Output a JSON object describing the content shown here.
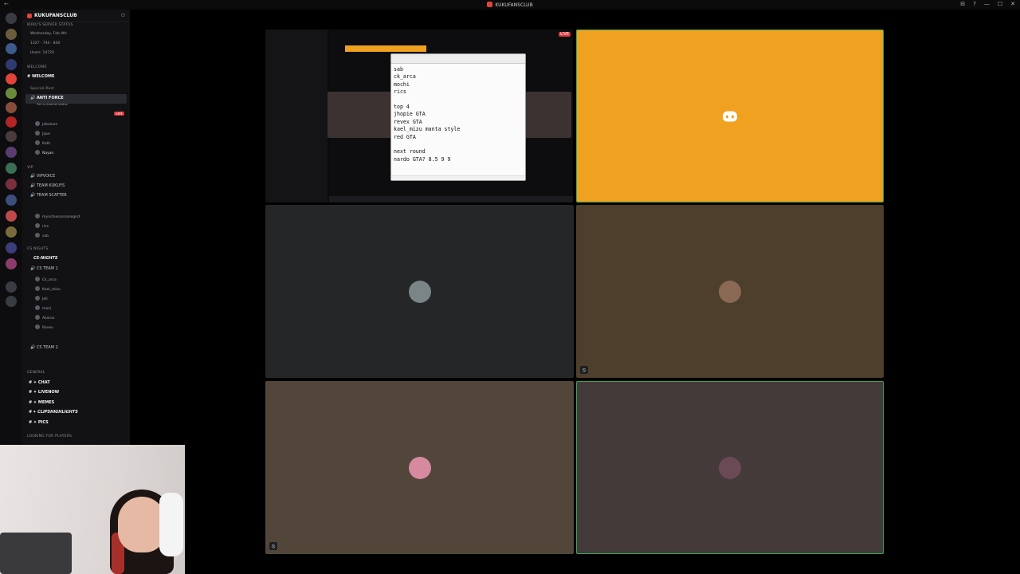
{
  "window": {
    "title": "KUKUFANSCLUB",
    "controls": [
      "⊟",
      "?",
      "—",
      "☐",
      "✕"
    ]
  },
  "server": {
    "name": "KUKUFANSCLUB",
    "status_header": "KUKU'S SERVER STATUS",
    "date": "Wednesday, Feb 4th",
    "counts": "1327 · 744 · 840",
    "users": "Users: 14720"
  },
  "channels": {
    "cat_welcome": "WELCOME",
    "welcome": "WELCOME",
    "cat_special": "Special-Rest",
    "anti_force": "ANTI FORCE",
    "anti_force_sub": "Set a channel status",
    "anti_force_users": [
      "Jaboleon",
      "Jape",
      "Kath",
      "Nayan"
    ],
    "live_badge": "LIVE",
    "cat_vip": "VIP",
    "vipvoice": "VIPVOICE",
    "team_kukuys": "TEAM KUKUYS",
    "team_scatter": "TEAM SCATTER",
    "team_scatter_users": [
      "mynchiesssssssegird",
      "rics",
      "sab"
    ],
    "cat_cs": "CS NIGHTS",
    "cs_nights": "CS-NIGHTS",
    "cs_team1": "CS TEAM 1",
    "cs_team1_users": [
      "Ck_arca",
      "Kael_mizu",
      "Jell",
      "mani",
      "Akarus",
      "Rovex"
    ],
    "cs_team2": "CS TEAM 2",
    "cat_general": "GENERAL",
    "chat": "CHAT",
    "livenow": "LIVENOW",
    "memes": "MEMES",
    "clips": "CLIPSHIGHLIGHTS",
    "pics": "PICS",
    "cat_lfp": "LOOKING FOR PLAYERS"
  },
  "stream": {
    "live_badge": "LIVE",
    "notepad_lines": "sab\nck_arca\nmochi\nrics\n\ntop 4\njhopie GTA\nrevex GTA\nkael_mizu manta style\nred GTA\n\nnext round\nnardo GTA? 8.5 9 9"
  },
  "colors": {
    "discord_orange": "#efa11f",
    "speaking_green": "#3ba55d",
    "live_red": "#da373c"
  },
  "icons": {
    "mute": "muted-mic-icon",
    "discord": "discord-logo-icon"
  }
}
